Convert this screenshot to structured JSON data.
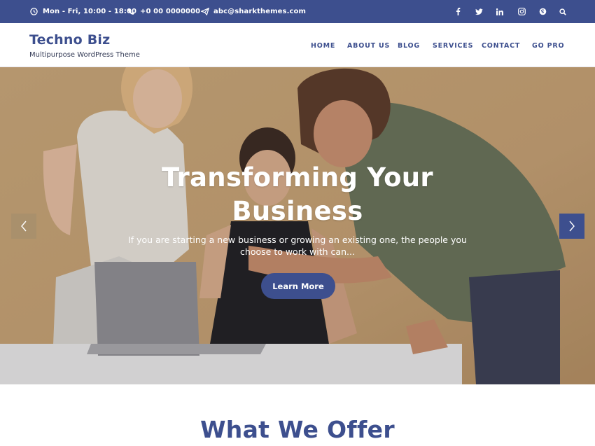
{
  "topbar": {
    "hours": "Mon - Fri, 10:00 - 18:00",
    "phone": "+0 00 0000000",
    "email": "abc@sharkthemes.com",
    "social": [
      {
        "name": "facebook-icon",
        "glyph": "f"
      },
      {
        "name": "twitter-icon",
        "glyph": "t"
      },
      {
        "name": "linkedin-icon",
        "glyph": "in"
      },
      {
        "name": "instagram-icon",
        "glyph": "ig"
      },
      {
        "name": "skype-icon",
        "glyph": "s"
      },
      {
        "name": "search-icon",
        "glyph": "search"
      }
    ]
  },
  "header": {
    "site_title": "Techno Biz",
    "tagline": "Multipurpose WordPress Theme"
  },
  "nav": {
    "items": [
      "HOME",
      "ABOUT US",
      "BLOG",
      "SERVICES",
      "CONTACT",
      "GO PRO"
    ]
  },
  "hero": {
    "title_line1": "Transforming Your",
    "title_line2": "Business",
    "subtitle_line1": "If you are starting a new business or growing an existing one, the people you",
    "subtitle_line2": "choose to work with can...",
    "button_label": "Learn More"
  },
  "section": {
    "title": "What We Offer"
  },
  "colors": {
    "brand": "#3d4f8e",
    "hero_bg": "#c8a77a"
  }
}
